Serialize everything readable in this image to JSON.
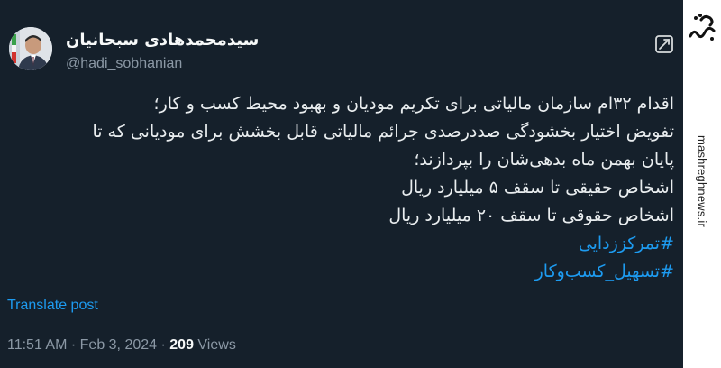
{
  "author": {
    "display_name": "سیدمحمدهادی سبحانیان",
    "handle": "@hadi_sobhanian"
  },
  "body_lines": [
    "اقدام ۳۲ام سازمان مالیاتی برای تکریم مودیان و بهبود محیط کسب و کار؛",
    "تفویض اختیار بخشودگی صددرصدی جرائم مالیاتی قابل بخشش برای مودیانی که تا",
    "پایان بهمن ماه بدهی‌شان را بپردازند؛",
    "اشخاص حقیقی تا سقف ۵ میلیارد ریال",
    "اشخاص حقوقی تا سقف ۲۰ میلیارد ریال"
  ],
  "hashtags": [
    "#تمرکززدایی",
    "#تسهیل_کسب‌وکار"
  ],
  "translate_label": "Translate post",
  "meta": {
    "time": "11:51 AM",
    "separator": " · ",
    "date": "Feb 3, 2024",
    "views_count": "209",
    "views_label": "Views"
  },
  "watermark": {
    "brand": "مشرق",
    "site": "mashreghnews.ir"
  },
  "colors": {
    "background": "#15202b",
    "text": "#f7f9f9",
    "secondary": "#8b98a5",
    "accent": "#1d9bf0"
  },
  "icons": {
    "avatar": "profile-photo",
    "grok": "grok-icon"
  }
}
